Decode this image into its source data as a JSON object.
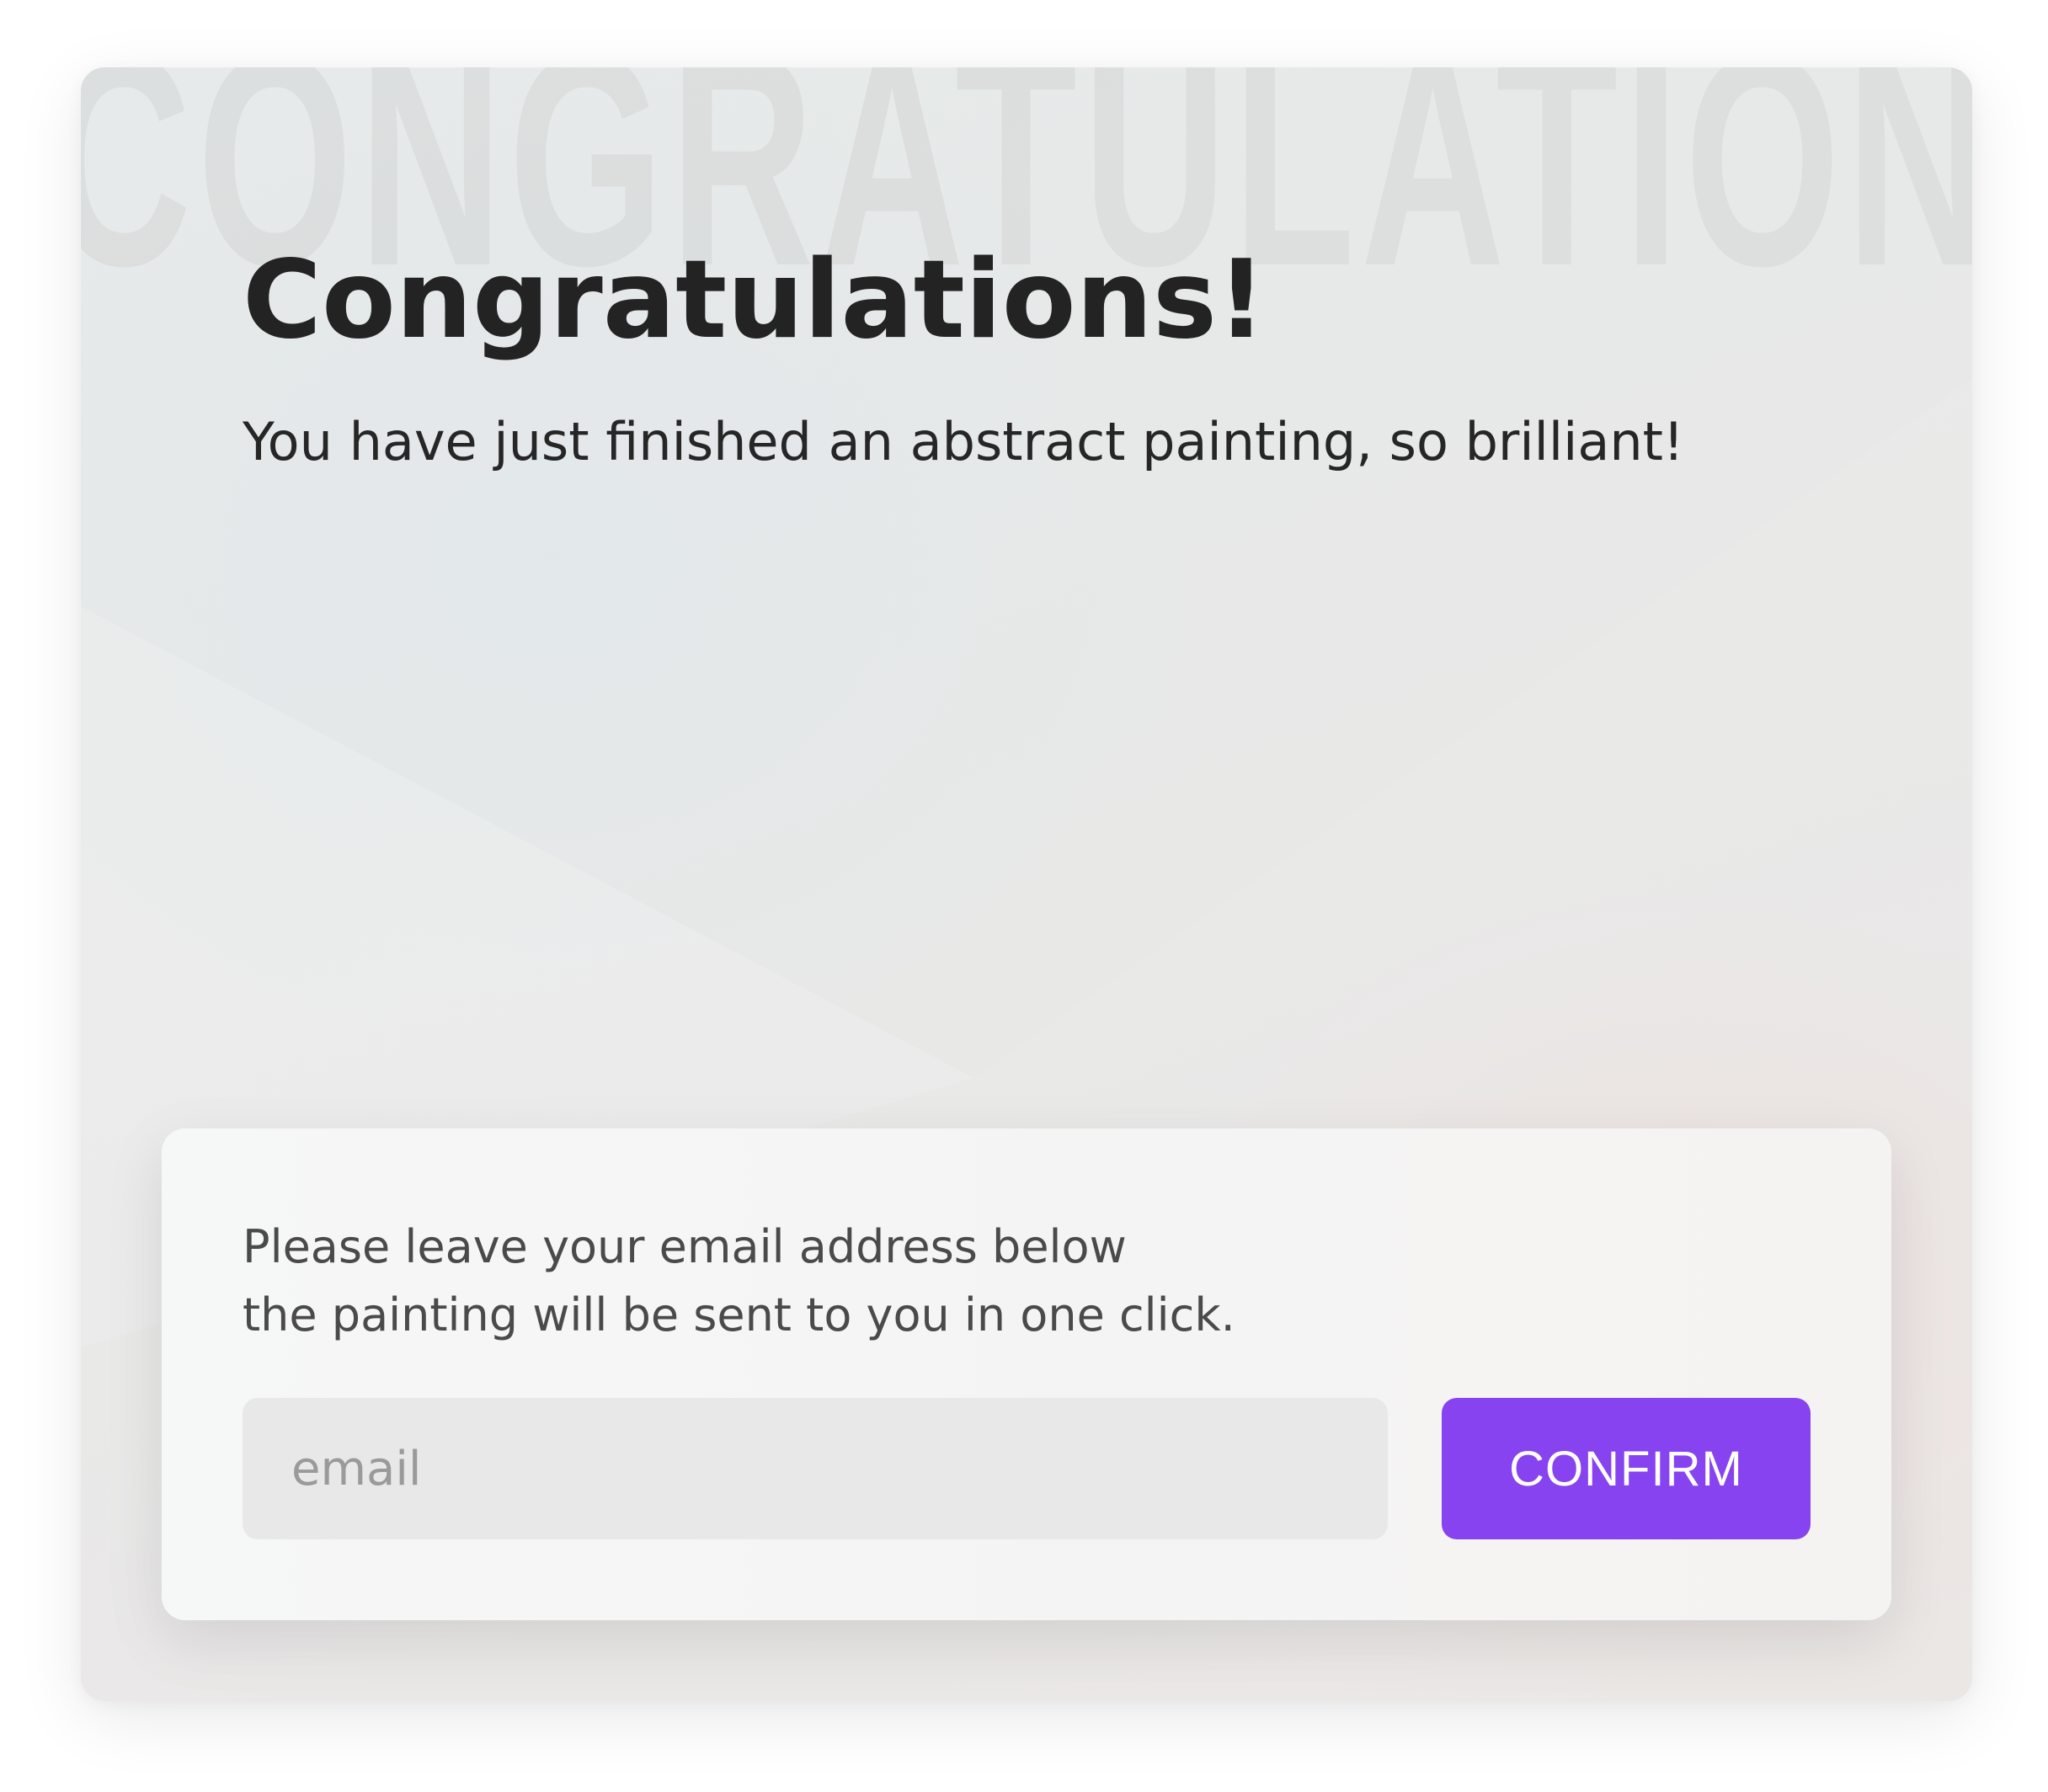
{
  "card": {
    "watermark": "CONGRATULATIONS",
    "title": "Congratulations!",
    "subtitle": "You have just finished an abstract painting, so brilliant!"
  },
  "form": {
    "prompt_line1": "Please leave your email address below",
    "prompt_line2": "the painting will be sent to you in one click.",
    "email_placeholder": "email",
    "email_value": "",
    "confirm_label": "CONFIRM"
  },
  "colors": {
    "accent": "#8743ef",
    "title": "#232323",
    "input_bg": "#e8e8e8"
  }
}
